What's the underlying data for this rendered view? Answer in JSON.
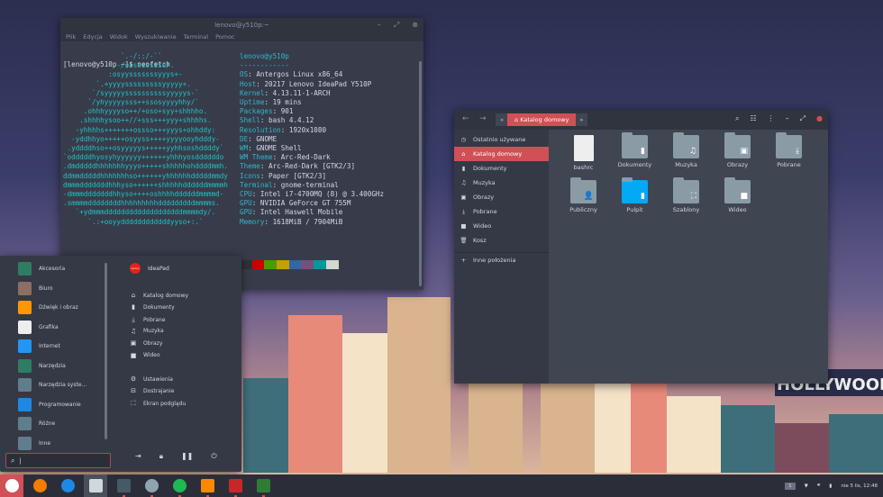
{
  "terminal": {
    "title": "lenovo@y510p:~",
    "menu": [
      "Plik",
      "Edycja",
      "Widok",
      "Wyszukiwanie",
      "Terminal",
      "Pomoc"
    ],
    "prompt": "[lenovo@y510p ~]$ neofetch",
    "art": [
      "              `.-/::/-``",
      "            .-/osssssssso/.",
      "           :osyysssssssyyys+-",
      "        `.+yyyysssssssssyyyyy+.",
      "       `/syyyyyssssssssssyyyyys-`",
      "      `/yhyyyyysss++ssosyyyyhhy/`",
      "     .ohhhyyyyso++/+oso+syy+shhhho.",
      "    .shhhhysoo++//+sss+++yyy+shhhhs.",
      "   -yhhhhs+++++++ossso+++yyys+ohhddy:",
      "  -yddhhyo+++++osyyss++++yyyyooyhdddy-",
      " .yddddhso++osyyyyys+++++yyhhsoshddddy`",
      "`odddddhyosyhyyyyyy++++++yhhhyosddddddo",
      ".dmdddddhhhhhhhyyyo+++++shhhhhohddddmmh.",
      "ddmmdddddhhhhhhhso++++++yhhhhhhdddddmmdy",
      "dmmmdddddddhhhyso++++++shhhhhddddddmmmmh",
      "-dmmmdddddddhhyso++++oshhhhddddddmmmmd-",
      ".smmmmddddddddhhhhhhhhhdddddddddmmmms.",
      "   `+ydmmmdddddddddddddddddddmmmmdy/.",
      "      `.:+ooyyddddddddddddyyso+:.`"
    ],
    "user": "lenovo@y510p",
    "sep": "------------",
    "info": [
      [
        "OS",
        "Antergos Linux x86_64"
      ],
      [
        "Host",
        "20217 Lenovo IdeaPad Y510P"
      ],
      [
        "Kernel",
        "4.13.11-1-ARCH"
      ],
      [
        "Uptime",
        "19 mins"
      ],
      [
        "Packages",
        "901"
      ],
      [
        "Shell",
        "bash 4.4.12"
      ],
      [
        "Resolution",
        "1920x1080"
      ],
      [
        "DE",
        "GNOME"
      ],
      [
        "WM",
        "GNOME Shell"
      ],
      [
        "WM Theme",
        "Arc-Red-Dark"
      ],
      [
        "Theme",
        "Arc-Red-Dark [GTK2/3]"
      ],
      [
        "Icons",
        "Paper [GTK2/3]"
      ],
      [
        "Terminal",
        "gnome-terminal"
      ],
      [
        "CPU",
        "Intel i7-4700MQ (8) @ 3.400GHz"
      ],
      [
        "GPU",
        "NVIDIA GeForce GT 755M"
      ],
      [
        "GPU",
        "Intel Haswell Mobile"
      ],
      [
        "Memory",
        "1618MiB / 7904MiB"
      ]
    ],
    "swatches": [
      "#2f3236",
      "#cc0000",
      "#4e9a06",
      "#c4a000",
      "#3465a4",
      "#75507b",
      "#06989a",
      "#d3d7cf"
    ]
  },
  "menu": {
    "categories": [
      {
        "label": "Akcesoria",
        "color": "#2e7d62"
      },
      {
        "label": "Biuro",
        "color": "#8d6e63"
      },
      {
        "label": "Dźwięk i obraz",
        "color": "#ff9800"
      },
      {
        "label": "Grafika",
        "color": "#eeeeee"
      },
      {
        "label": "Internet",
        "color": "#2196f3"
      },
      {
        "label": "Narzędzia",
        "color": "#2e7d62"
      },
      {
        "label": "Narzędzia syste...",
        "color": "#607d8b"
      },
      {
        "label": "Programowanie",
        "color": "#1e88e5"
      },
      {
        "label": "Różne",
        "color": "#607d8b"
      },
      {
        "label": "Inne",
        "color": "#607d8b"
      }
    ],
    "user": "IdeaPad",
    "brand": "Lenovo",
    "places": [
      {
        "icon": "home-icon",
        "g": "⌂",
        "label": "Katalog domowy"
      },
      {
        "icon": "document-icon",
        "g": "▮",
        "label": "Dokumenty"
      },
      {
        "icon": "download-icon",
        "g": "⤓",
        "label": "Pobrane"
      },
      {
        "icon": "music-icon",
        "g": "♫",
        "label": "Muzyka"
      },
      {
        "icon": "image-icon",
        "g": "▣",
        "label": "Obrazy"
      },
      {
        "icon": "video-icon",
        "g": "■",
        "label": "Wideo"
      }
    ],
    "system": [
      {
        "icon": "gear-icon",
        "g": "⚙",
        "label": "Ustawienia"
      },
      {
        "icon": "tweaks-icon",
        "g": "⊟",
        "label": "Dostrajanie"
      },
      {
        "icon": "screenshot-icon",
        "g": "⛶",
        "label": "Ekran podglądu"
      }
    ],
    "search_value": "|"
  },
  "files": {
    "location": "Katalog domowy",
    "sidebar": [
      {
        "g": "◷",
        "label": "Ostatnio używane"
      },
      {
        "g": "⌂",
        "label": "Katalog domowy",
        "active": true
      },
      {
        "g": "▮",
        "label": "Dokumenty"
      },
      {
        "g": "♫",
        "label": "Muzyka"
      },
      {
        "g": "▣",
        "label": "Obrazy"
      },
      {
        "g": "⤓",
        "label": "Pobrane"
      },
      {
        "g": "■",
        "label": "Wideo"
      },
      {
        "g": "🗑",
        "label": "Kosz"
      },
      {
        "g": "+",
        "label": "Inne położenia"
      }
    ],
    "items": [
      {
        "label": "bashrc",
        "type": "file"
      },
      {
        "label": "Dokumenty",
        "g": "▮"
      },
      {
        "label": "Muzyka",
        "g": "♫"
      },
      {
        "label": "Obrazy",
        "g": "▣"
      },
      {
        "label": "Pobrane",
        "g": "⤓"
      },
      {
        "label": "Publiczny",
        "g": "👤"
      },
      {
        "label": "Pulpit",
        "g": "▮",
        "accent": "#03a9f4"
      },
      {
        "label": "Szablony",
        "g": "⛶"
      },
      {
        "label": "Wideo",
        "g": "■"
      }
    ]
  },
  "taskbar": {
    "apps": [
      {
        "name": "antergos",
        "color": "#d05055"
      },
      {
        "name": "updater",
        "color": "#f57c00"
      },
      {
        "name": "installer",
        "color": "#1e88e5"
      },
      {
        "name": "files",
        "color": "#cfd8dc"
      },
      {
        "name": "terminal",
        "color": "#455a64"
      },
      {
        "name": "chromium",
        "color": "#90a4ae"
      },
      {
        "name": "spotify",
        "color": "#1db954"
      },
      {
        "name": "vlc",
        "color": "#ff8800"
      },
      {
        "name": "tweak",
        "color": "#c62828"
      },
      {
        "name": "system-monitor",
        "color": "#2e7d32"
      }
    ],
    "workspace": "1",
    "clock": "nie 5 lis, 12:48"
  },
  "wallpaper": {
    "sign": "HOLLYWOOD"
  }
}
